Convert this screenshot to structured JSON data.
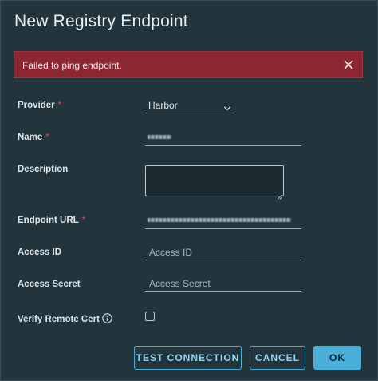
{
  "dialog": {
    "title": "New Registry Endpoint"
  },
  "alert": {
    "message": "Failed to ping endpoint.",
    "close_icon": "close-icon",
    "color": "#8c2731"
  },
  "form": {
    "provider": {
      "label": "Provider",
      "required_mark": "*",
      "value": "Harbor",
      "icon": "chevron-down-icon"
    },
    "name": {
      "label": "Name",
      "required_mark": "*"
    },
    "description": {
      "label": "Description"
    },
    "endpoint_url": {
      "label": "Endpoint URL",
      "required_mark": "*"
    },
    "access_id": {
      "label": "Access ID",
      "placeholder": "Access ID"
    },
    "access_secret": {
      "label": "Access Secret",
      "placeholder": "Access Secret"
    },
    "verify_remote_cert": {
      "label": "Verify Remote Cert",
      "icon": "info-icon",
      "checked": false
    }
  },
  "buttons": {
    "test_connection": "TEST CONNECTION",
    "cancel": "CANCEL",
    "ok": "OK",
    "accent_color": "#49afd9"
  }
}
